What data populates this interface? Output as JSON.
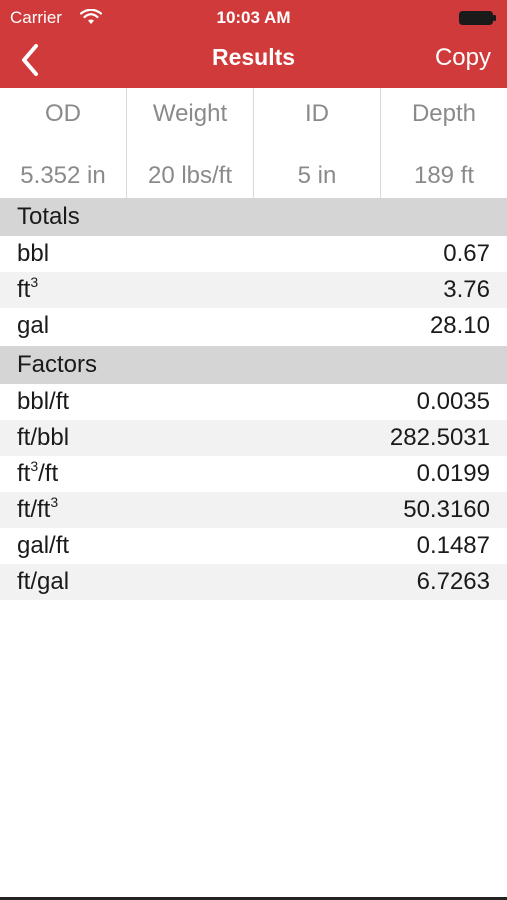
{
  "status_bar": {
    "carrier": "Carrier",
    "time": "10:03 AM"
  },
  "navbar": {
    "title": "Results",
    "copy_label": "Copy"
  },
  "params": [
    {
      "label": "OD",
      "value": "5.352 in"
    },
    {
      "label": "Weight",
      "value": "20 lbs/ft"
    },
    {
      "label": "ID",
      "value": "5 in"
    },
    {
      "label": "Depth",
      "value": "189 ft"
    }
  ],
  "totals": {
    "header": "Totals",
    "rows": [
      {
        "label": "bbl",
        "value": "0.67"
      },
      {
        "label": "ft",
        "sup": "3",
        "value": "3.76"
      },
      {
        "label": "gal",
        "value": "28.10"
      }
    ]
  },
  "factors": {
    "header": "Factors",
    "rows": [
      {
        "label": "bbl/ft",
        "value": "0.0035"
      },
      {
        "label": "ft/bbl",
        "value": "282.5031"
      },
      {
        "label": "ft",
        "sup": "3",
        "suffix": "/ft",
        "value": "0.0199"
      },
      {
        "label": "ft/ft",
        "sup": "3",
        "value": "50.3160"
      },
      {
        "label": "gal/ft",
        "value": "0.1487"
      },
      {
        "label": "ft/gal",
        "value": "6.7263"
      }
    ]
  },
  "colors": {
    "accent": "#d13a3a",
    "section": "#d5d5d5",
    "stripe": "#f2f2f2"
  }
}
